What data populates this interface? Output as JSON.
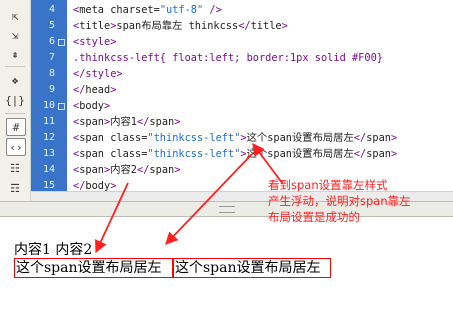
{
  "editor": {
    "lines": [
      {
        "num": "4",
        "tokens": [
          [
            "p",
            "<"
          ],
          [
            "t",
            "meta"
          ],
          [
            "t",
            " charset="
          ],
          [
            "st",
            "\"utf-8\""
          ],
          [
            "p",
            " />"
          ]
        ]
      },
      {
        "num": "5",
        "tokens": [
          [
            "p",
            "<"
          ],
          [
            "t",
            "title"
          ],
          [
            "p",
            ">"
          ],
          [
            "t",
            "span布局靠左 thinkcss"
          ],
          [
            "p",
            "</"
          ],
          [
            "t",
            "title"
          ],
          [
            "p",
            ">"
          ]
        ]
      },
      {
        "num": "6",
        "tokens": [
          [
            "p",
            "<style>"
          ]
        ]
      },
      {
        "num": "7",
        "tokens": [
          [
            "at",
            ".thinkcss-left{ float:left; border:1px solid #F00}"
          ]
        ]
      },
      {
        "num": "8",
        "tokens": [
          [
            "p",
            "</style>"
          ]
        ]
      },
      {
        "num": "9",
        "tokens": [
          [
            "p",
            "</"
          ],
          [
            "t",
            "head"
          ],
          [
            "p",
            ">"
          ]
        ]
      },
      {
        "num": "10",
        "tokens": [
          [
            "p",
            "<"
          ],
          [
            "t",
            "body"
          ],
          [
            "p",
            ">"
          ]
        ]
      },
      {
        "num": "11",
        "tokens": [
          [
            "p",
            "<"
          ],
          [
            "t",
            "span"
          ],
          [
            "p",
            ">"
          ],
          [
            "t",
            "内容1"
          ],
          [
            "p",
            "</"
          ],
          [
            "t",
            "span"
          ],
          [
            "p",
            ">"
          ]
        ]
      },
      {
        "num": "12",
        "tokens": [
          [
            "p",
            "<"
          ],
          [
            "t",
            "span class="
          ],
          [
            "st",
            "\"thinkcss-left\""
          ],
          [
            "p",
            ">"
          ],
          [
            "t",
            "这个span设置布局居左"
          ],
          [
            "p",
            "</"
          ],
          [
            "t",
            "span"
          ],
          [
            "p",
            ">"
          ]
        ]
      },
      {
        "num": "13",
        "tokens": [
          [
            "p",
            "<"
          ],
          [
            "t",
            "span class="
          ],
          [
            "st",
            "\"thinkcss-left\""
          ],
          [
            "p",
            ">"
          ],
          [
            "t",
            "这个span设置布局居左"
          ],
          [
            "p",
            "</"
          ],
          [
            "t",
            "span"
          ],
          [
            "p",
            ">"
          ]
        ]
      },
      {
        "num": "14",
        "tokens": [
          [
            "p",
            "<"
          ],
          [
            "t",
            "span"
          ],
          [
            "p",
            ">"
          ],
          [
            "t",
            "内容2"
          ],
          [
            "p",
            "</"
          ],
          [
            "t",
            "span"
          ],
          [
            "p",
            ">"
          ]
        ]
      },
      {
        "num": "15",
        "tokens": [
          [
            "p",
            "</"
          ],
          [
            "t",
            "body"
          ],
          [
            "p",
            ">"
          ]
        ]
      },
      {
        "num": "16",
        "tokens": [
          [
            "p",
            "</"
          ],
          [
            "t",
            "html"
          ],
          [
            "p",
            ">"
          ]
        ]
      }
    ]
  },
  "preview": {
    "line1": "内容1 内容2",
    "box1": "这个span设置布局居左",
    "box2": "这个span设置布局居左"
  },
  "annotation": {
    "lines": [
      "看到span设置靠左样式",
      "产生浮动，说明对span靠左",
      "布局设置是成功的"
    ],
    "color": "#ff2020"
  },
  "colors": {
    "gutter": "#3a74c8",
    "float_border": "#ff0000"
  }
}
